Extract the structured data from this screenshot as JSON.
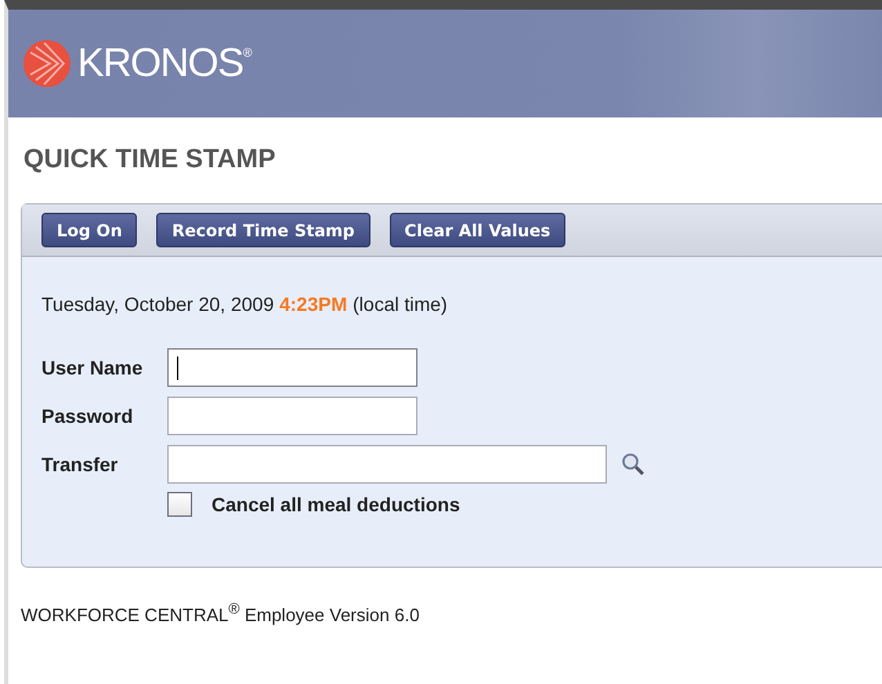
{
  "header": {
    "logo": "KRONOS$^{®}$"
  },
  "page_title": "QUICK TIME STAMP",
  "toolbar": {
    "buttons": [
      "Log On",
      "Record Time Stamp",
      "Clear All Values"
    ]
  },
  "clock": {
    "date": "Tuesday, October 20, 2009",
    "time": "4:23PM",
    "suffix": "(local time)"
  },
  "fields": [
    {
      "label": "User Name",
      "kind": "short",
      "focused": true
    },
    {
      "label": "Password",
      "kind": "short",
      "focused": false
    },
    {
      "label": "Transfer",
      "kind": "lookup",
      "focused": false
    }
  ],
  "options": [
    {
      "label": "Cancel all meal deductions",
      "checked": false
    }
  ],
  "footer": "WORKFORCE CENTRAL$^{®}$ Employee Version 6.0"
}
